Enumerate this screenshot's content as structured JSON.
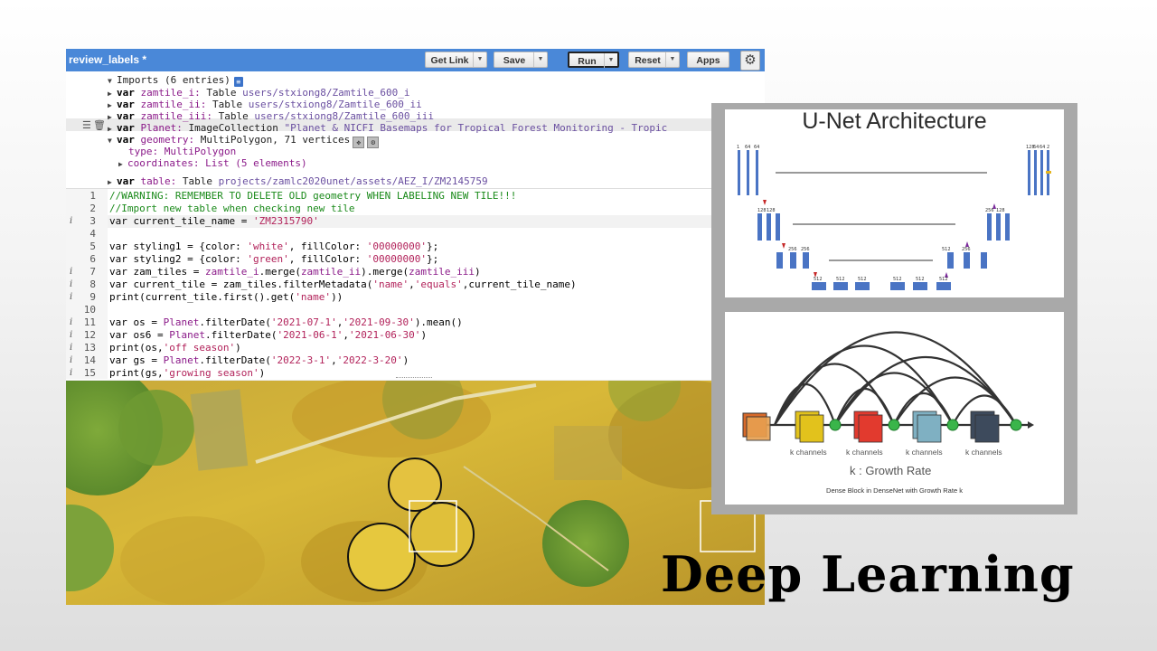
{
  "editor": {
    "title": "review_labels *",
    "toolbar": {
      "get_link": "Get Link",
      "save": "Save",
      "run": "Run",
      "reset": "Reset",
      "apps": "Apps",
      "settings_icon": "gear-icon"
    },
    "imports": {
      "header": "Imports (6 entries)",
      "rows": [
        {
          "kw": "var",
          "name": "zamtile_i:",
          "type": "Table",
          "path": "users/stxiong8/Zamtile_600_i"
        },
        {
          "kw": "var",
          "name": "zamtile_ii:",
          "type": "Table",
          "path": "users/stxiong8/Zamtile_600_ii"
        },
        {
          "kw": "var",
          "name": "zamtile_iii:",
          "type": "Table",
          "path": "users/stxiong8/Zamtile_600_iii"
        },
        {
          "kw": "var",
          "name": "Planet:",
          "type": "ImageCollection",
          "path": "\"Planet & NICFI Basemaps for Tropical Forest Monitoring - Tropic"
        },
        {
          "kw": "var",
          "name": "geometry:",
          "type": "MultiPolygon, 71 vertices",
          "path": ""
        }
      ],
      "geometry_type": "type: MultiPolygon",
      "geometry_coords": "coordinates: List (5 elements)",
      "table_row": {
        "kw": "var",
        "name": "table:",
        "type": "Table",
        "path": "projects/zamlc2020unet/assets/AEZ_I/ZM2145759"
      }
    },
    "code_lines": [
      {
        "n": "1",
        "info": false,
        "parts": [
          {
            "c": "cm",
            "t": "//WARNING: REMEMBER TO DELETE OLD geometry WHEN LABELING NEW TILE!!!"
          }
        ]
      },
      {
        "n": "2",
        "info": false,
        "parts": [
          {
            "c": "cm",
            "t": "//Import new table when checking new tile"
          }
        ]
      },
      {
        "n": "3",
        "info": true,
        "parts": [
          {
            "c": "",
            "t": "var current_tile_name = "
          },
          {
            "c": "st",
            "t": "'ZM2315790'"
          }
        ]
      },
      {
        "n": "4",
        "info": false,
        "parts": [
          {
            "c": "",
            "t": ""
          }
        ]
      },
      {
        "n": "5",
        "info": false,
        "parts": [
          {
            "c": "",
            "t": "var styling1 = {color: "
          },
          {
            "c": "st",
            "t": "'white'"
          },
          {
            "c": "",
            "t": ", fillColor: "
          },
          {
            "c": "st",
            "t": "'00000000'"
          },
          {
            "c": "",
            "t": "};"
          }
        ]
      },
      {
        "n": "6",
        "info": false,
        "parts": [
          {
            "c": "",
            "t": "var styling2 = {color: "
          },
          {
            "c": "st",
            "t": "'green'"
          },
          {
            "c": "",
            "t": ", fillColor: "
          },
          {
            "c": "st",
            "t": "'00000000'"
          },
          {
            "c": "",
            "t": "};"
          }
        ]
      },
      {
        "n": "7",
        "info": true,
        "parts": [
          {
            "c": "",
            "t": "var zam_tiles = "
          },
          {
            "c": "vn",
            "t": "zamtile_i"
          },
          {
            "c": "",
            "t": ".merge("
          },
          {
            "c": "vn",
            "t": "zamtile_ii"
          },
          {
            "c": "",
            "t": ").merge("
          },
          {
            "c": "vn",
            "t": "zamtile_iii"
          },
          {
            "c": "",
            "t": ")"
          }
        ]
      },
      {
        "n": "8",
        "info": true,
        "parts": [
          {
            "c": "",
            "t": "var current_tile = zam_tiles.filterMetadata("
          },
          {
            "c": "st",
            "t": "'name'"
          },
          {
            "c": "",
            "t": ","
          },
          {
            "c": "st",
            "t": "'equals'"
          },
          {
            "c": "",
            "t": ",current_tile_name)"
          }
        ]
      },
      {
        "n": "9",
        "info": true,
        "parts": [
          {
            "c": "",
            "t": "print(current_tile.first().get("
          },
          {
            "c": "st",
            "t": "'name'"
          },
          {
            "c": "",
            "t": "))"
          }
        ]
      },
      {
        "n": "10",
        "info": false,
        "parts": [
          {
            "c": "",
            "t": ""
          }
        ]
      },
      {
        "n": "11",
        "info": true,
        "parts": [
          {
            "c": "",
            "t": "var os = "
          },
          {
            "c": "vn",
            "t": "Planet"
          },
          {
            "c": "",
            "t": ".filterDate("
          },
          {
            "c": "st",
            "t": "'2021-07-1'"
          },
          {
            "c": "",
            "t": ","
          },
          {
            "c": "st",
            "t": "'2021-09-30'"
          },
          {
            "c": "",
            "t": ").mean()"
          }
        ]
      },
      {
        "n": "12",
        "info": true,
        "parts": [
          {
            "c": "",
            "t": "var os6 = "
          },
          {
            "c": "vn",
            "t": "Planet"
          },
          {
            "c": "",
            "t": ".filterDate("
          },
          {
            "c": "st",
            "t": "'2021-06-1'"
          },
          {
            "c": "",
            "t": ","
          },
          {
            "c": "st",
            "t": "'2021-06-30'"
          },
          {
            "c": "",
            "t": ")"
          }
        ]
      },
      {
        "n": "13",
        "info": true,
        "parts": [
          {
            "c": "",
            "t": "print(os,"
          },
          {
            "c": "st",
            "t": "'off season'"
          },
          {
            "c": "",
            "t": ")"
          }
        ]
      },
      {
        "n": "14",
        "info": true,
        "parts": [
          {
            "c": "",
            "t": "var gs = "
          },
          {
            "c": "vn",
            "t": "Planet"
          },
          {
            "c": "",
            "t": ".filterDate("
          },
          {
            "c": "st",
            "t": "'2022-3-1'"
          },
          {
            "c": "",
            "t": ","
          },
          {
            "c": "st",
            "t": "'2022-3-20'"
          },
          {
            "c": "",
            "t": ")"
          }
        ]
      },
      {
        "n": "15",
        "info": true,
        "parts": [
          {
            "c": "",
            "t": "print(gs,"
          },
          {
            "c": "st",
            "t": "'growing season'"
          },
          {
            "c": "",
            "t": ")"
          }
        ]
      }
    ]
  },
  "unet": {
    "title": "U-Net Architecture",
    "labels": [
      "1",
      "64",
      "64",
      "128",
      "64",
      "64",
      "2",
      "128",
      "128",
      "256",
      "128",
      "256",
      "256",
      "512",
      "256",
      "512",
      "512",
      "512",
      "512",
      "512",
      "512"
    ]
  },
  "densenet": {
    "channel_label": "k channels",
    "growth_rate": "k : Growth Rate",
    "caption": "Dense Block in DenseNet with Growth Rate k",
    "block_colors": [
      "#e2c21c",
      "#e23a2e",
      "#7fb0c2",
      "#3d4a5c"
    ],
    "node_color": "#3ab54a"
  },
  "slide_title": "Deep Learning"
}
